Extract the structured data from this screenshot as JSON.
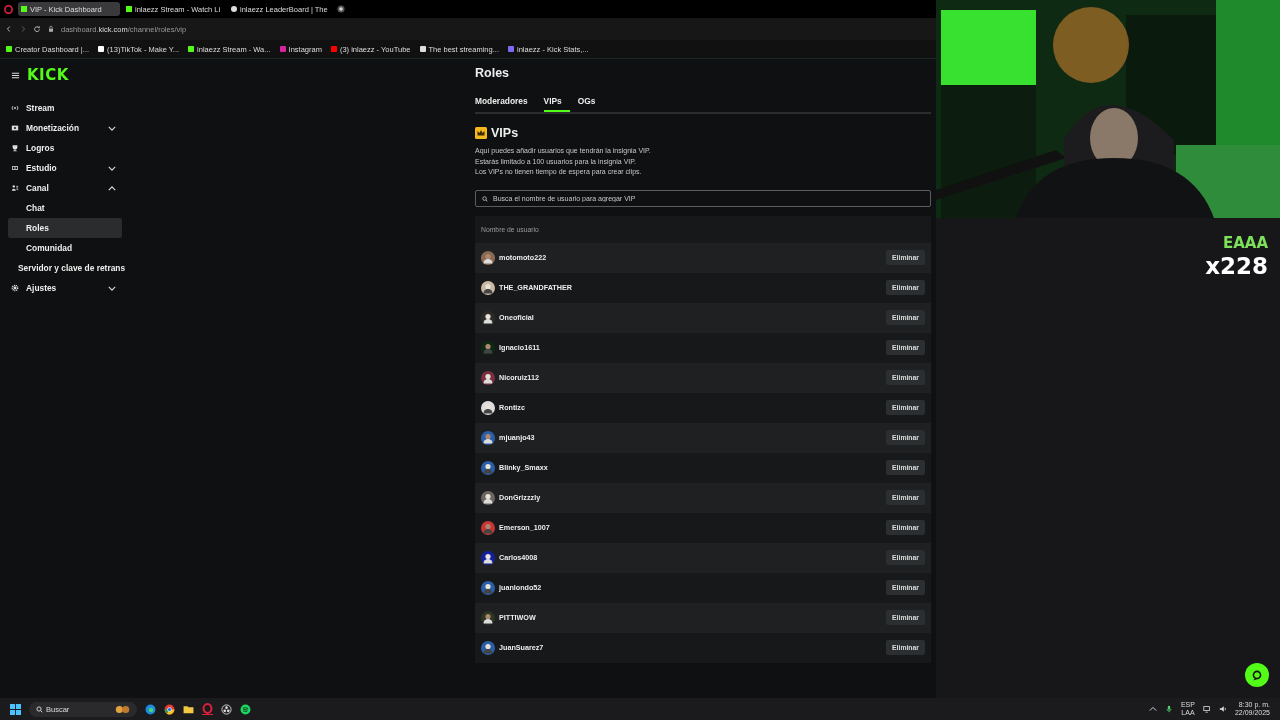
{
  "browser": {
    "tabs": [
      {
        "title": "VIP - Kick Dashboard",
        "selected": true
      },
      {
        "title": "inlaezz Stream - Watch Li",
        "selected": false
      },
      {
        "title": "inlaezz LeaderBoard | The",
        "selected": false
      }
    ],
    "url": {
      "host": "dashboard.",
      "domain": "kick.com",
      "path": "/channel/roles/vip"
    },
    "bookmarks": [
      "Creator Dashboard |...",
      "(13)TikTok - Make Y...",
      "inlaezz Stream - Wa...",
      "Instagram",
      "(3) inlaezz - YouTube",
      "The best streaming...",
      "inlaezz - Kick Stats,..."
    ]
  },
  "logo": "KICK",
  "sidebar": [
    {
      "label": "Stream",
      "kind": "stream",
      "selected": false
    },
    {
      "label": "Monetización",
      "kind": "money",
      "expanded": false,
      "selected": false
    },
    {
      "label": "Logros",
      "kind": "trophy",
      "selected": false
    },
    {
      "label": "Estudio",
      "kind": "studio",
      "expanded": false,
      "selected": false
    },
    {
      "label": "Canal",
      "kind": "channel",
      "expanded": true,
      "selected": false,
      "children": [
        {
          "label": "Chat",
          "selected": false
        },
        {
          "label": "Roles",
          "selected": true
        },
        {
          "label": "Comunidad",
          "selected": false
        }
      ]
    },
    {
      "label": "Servidor y clave de retrans",
      "kind": "plain",
      "selected": false
    },
    {
      "label": "Ajustes",
      "kind": "gear",
      "expanded": false,
      "selected": false
    }
  ],
  "page_title": "Roles",
  "tabs": [
    {
      "label": "Moderadores",
      "selected": false
    },
    {
      "label": "VIPs",
      "selected": true
    },
    {
      "label": "OGs",
      "selected": false
    }
  ],
  "section": {
    "title": "VIPs",
    "description": [
      "Aquí puedes añadir usuarios que tendrán la insignia VIP.",
      "Estarás limitado a 100 usuarios para la insignia VIP.",
      "Los VIPs no tienen tiempo de espera para crear clips."
    ]
  },
  "search": {
    "placeholder": "Busca el nombre de usuario para agregar VIP"
  },
  "table": {
    "column": "Nombre de usuario",
    "rows": [
      {
        "username": "motomoto222",
        "action": "Eliminar"
      },
      {
        "username": "THE_GRANDFATHER",
        "action": "Eliminar"
      },
      {
        "username": "Oneoficial",
        "action": "Eliminar"
      },
      {
        "username": "Ignacio1611",
        "action": "Eliminar"
      },
      {
        "username": "Nicoruiz112",
        "action": "Eliminar"
      },
      {
        "username": "Rontizc",
        "action": "Eliminar"
      },
      {
        "username": "mjuanjo43",
        "action": "Eliminar"
      },
      {
        "username": "Blinky_Smaxx",
        "action": "Eliminar"
      },
      {
        "username": "DonGrizzzly",
        "action": "Eliminar"
      },
      {
        "username": "Emerson_1007",
        "action": "Eliminar"
      },
      {
        "username": "Carlos4008",
        "action": "Eliminar"
      },
      {
        "username": "juanlondo52",
        "action": "Eliminar"
      },
      {
        "username": "PITTIWOW",
        "action": "Eliminar"
      },
      {
        "username": "JuanSuarez7",
        "action": "Eliminar"
      }
    ]
  },
  "overlay": {
    "caption": "EAAA",
    "count": "x228"
  },
  "taskbar": {
    "search": {
      "placeholder": "Buscar"
    },
    "lang": [
      "ESP",
      "LAA"
    ],
    "time": "8:30 p. m.",
    "date": "22/09/2025"
  }
}
